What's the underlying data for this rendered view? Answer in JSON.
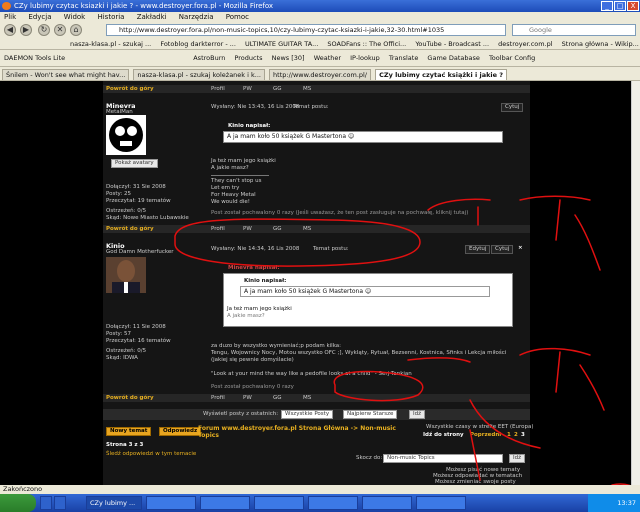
{
  "window": {
    "title": "CZy lubimy czytac ksiazki i jakie ? - www.destroyer.fora.pl - Mozilla Firefox",
    "min": "_",
    "max": "□",
    "close": "X"
  },
  "menu": [
    "Plik",
    "Edycja",
    "Widok",
    "Historia",
    "Zakładki",
    "Narzędzia",
    "Pomoc"
  ],
  "nav": {
    "url": "http://www.destroyer.fora.pl/non-music-topics,10/czy-lubimy-czytac-ksiazki-i-jakie,32-30.html#1035",
    "search_placeholder": "Google"
  },
  "bookmarks1": [
    "nasza-klasa.pl - szukaj ...",
    "Fotoblog darkterror - ...",
    "ULTIMATE GUITAR TA...",
    "SOADFans :: The Offici...",
    "YouTube - Broadcast ...",
    "destroyer.com.pl",
    "Strona główna - Wikip..."
  ],
  "bookmarks2": [
    "DAEMON Tools Lite",
    "AstroBurn",
    "Products",
    "News [30]",
    "Weather",
    "IP-lookup",
    "Translate",
    "Game Database",
    "Toolbar Config"
  ],
  "tabs": [
    "Śnilem - Won't see what might hav...",
    "nasza-klasa.pl - szukaj koleżanek i k...",
    "http://www.destroyer.com.pl/",
    "CZy lubimy czytać książki i jakie ?"
  ],
  "forum": {
    "post_actions": [
      "Profil",
      "PW",
      "GG",
      "MS"
    ],
    "back_to_top": "Powrót do góry",
    "post1": {
      "author": "Minevra",
      "rank": "MetalMan",
      "show_avatars": "Pokaż avatary",
      "posted": "Wysłany: Nie 13:43, 16 Lis 2008",
      "topic": "Temat postu:",
      "quote_label": "Cytuj",
      "quote_author": "Kinio napisał:",
      "quote_text": "A ja mam koło 50 książek G Mastertona",
      "body": [
        "Ja też mam jego książki",
        "A jakie masz?",
        "They can't stop us",
        "Let em try",
        "For Heavy Metal",
        "We would die!"
      ],
      "praise": "Post został pochwalony 0 razy (Jeśli uważasz, że ten post zasługuje na pochwałę, kliknij tutaj)",
      "joined": "Dołączył: 31 Sie 2008",
      "posts": "Posty: 25",
      "read": "Przeczytał: 19 tematów",
      "warnings": "Ostrzeżeń: 0/5",
      "from": "Skąd: Nowe Miasto Lubawskie"
    },
    "post2": {
      "author": "Kinio",
      "rank": "God Damn Motherfucker",
      "posted": "Wysłany: Nie 14:34, 16 Lis 2008",
      "topic": "Temat postu:",
      "edit_label": "Edytuj",
      "quote_label": "Cytuj",
      "outer_quote": "Minevra napisał:",
      "quote_author": "Kinio napisał:",
      "quote_text": "A ja mam koło 50 książek G Mastertona",
      "quote_body": [
        "Ja też mam jego książki",
        "A jakie masz?"
      ],
      "body": [
        "za duzo by wszystko wymieniać;p podam kilka:",
        "Tengu, Wojownicy Nocy, Motou wszystko OFC ;], Wykląty, Rytuał, Bezsenni, Kostnica, Sfinks i Lekcja miłości",
        "(jakiej się pewnie domyślacie)"
      ],
      "lyric": "\"Look at your mind the way like a pedofile looks at a child\" - Serj Tankian",
      "praise": "Post został pochwalony 0 razy",
      "joined": "Dołączył: 11 Sie 2008",
      "posts": "Posty: 57",
      "read": "Przeczytał: 16 tematów",
      "warnings": "Ostrzeżeń: 0/5",
      "from": "Skąd: IDWA"
    },
    "filter": {
      "label": "Wyświetl posty z ostatnich:",
      "all_posts": "Wszystkie Posty",
      "order": "Najpierw Starsze",
      "go": "Idź"
    },
    "new_topic": "Nowy temat",
    "reply": "Odpowiedz",
    "breadcrumb": "Forum www.destroyer.fora.pl Strona Główna -> Non-music Topics",
    "timezone": "Wszystkie czasy w strefie EET (Europa)",
    "goto_page": "Idź do strony",
    "prev": "Poprzedni",
    "pages": [
      "1",
      "2",
      "3"
    ],
    "page_of": "Strona 3 z 3",
    "watch": "Śledź odpowiedzi w tym temacie",
    "jump_label": "Skocz do:",
    "jump_value": "Non-music Topics",
    "perms": [
      "Możesz pisać nowe tematy",
      "Możesz odpowiadać w tematach",
      "Możesz zmieniać swoje posty"
    ]
  },
  "status": "Zakończono",
  "taskbar": {
    "tasks": [
      "CZy lubimy ..."
    ],
    "clock": "13:37"
  },
  "colors": {
    "forum_bg": "#151515",
    "accent": "#e8b020",
    "annotation": "#e01010"
  }
}
